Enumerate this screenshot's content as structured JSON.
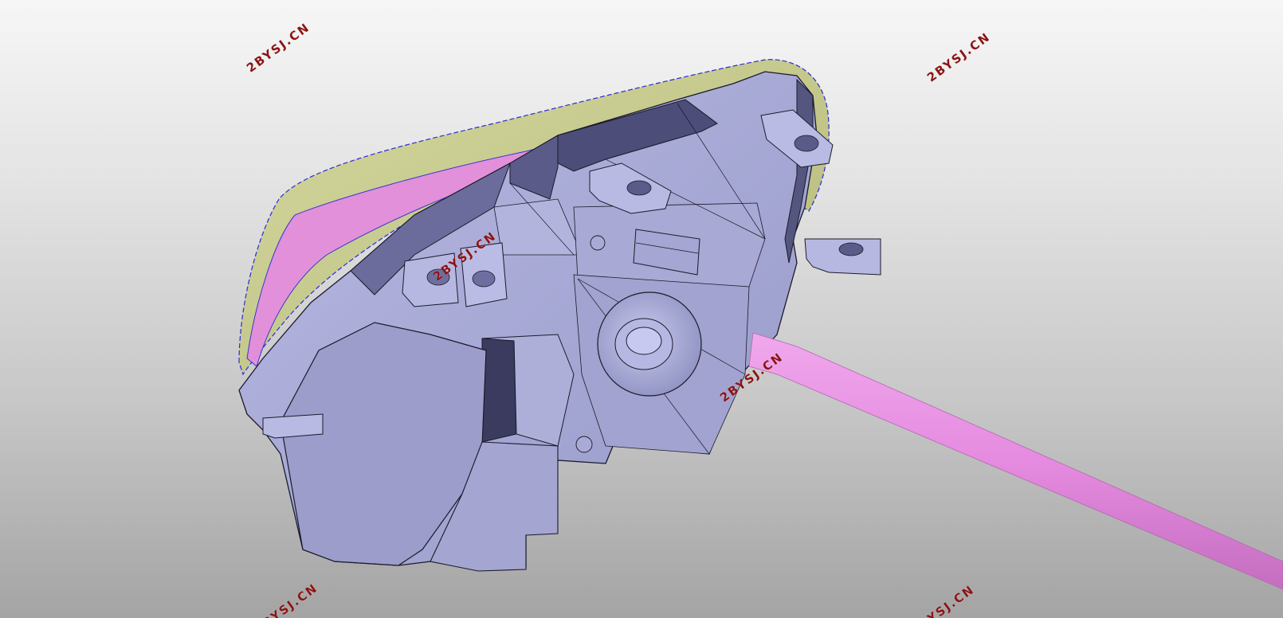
{
  "viewport": {
    "background_top": "#f6f6f6",
    "background_bottom": "#a4a4a4"
  },
  "model": {
    "body_color": "#a9aad6",
    "body_shadow_color": "#8486b8",
    "dark_face_color": "#4c4d78",
    "lens_color": "#c4c88c",
    "accent_color": "#e58be0",
    "edge_color": "#1a1a2a",
    "outline_dash_color": "#2b2bd6"
  },
  "watermarks": [
    {
      "id": "wm-1",
      "text": "2BYSJ.CN"
    },
    {
      "id": "wm-2",
      "text": "2BYSJ.CN"
    },
    {
      "id": "wm-3",
      "text": "2BYSJ.CN"
    },
    {
      "id": "wm-4",
      "text": "2BYSJ.CN"
    },
    {
      "id": "wm-5",
      "text": "2BYSJ.CN"
    },
    {
      "id": "wm-6",
      "text": "2BYSJ.CN"
    }
  ],
  "watermark_color": "#8c1414"
}
